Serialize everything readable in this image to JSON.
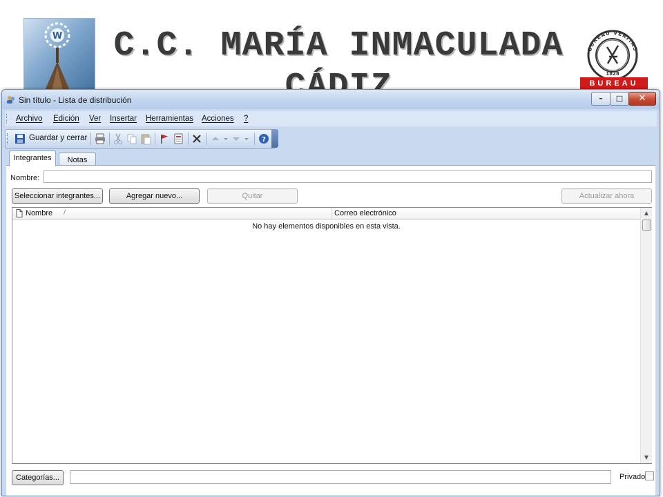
{
  "slide": {
    "title_line1": "C.C. MARÍA INMACULADA",
    "title_line2": "CÁDIZ",
    "certifier_arc_text": "BUREAU VERITAS",
    "certifier_year": "1828",
    "certifier_bar": "BUREAU"
  },
  "window": {
    "title": "Sin título - Lista de distribución",
    "controls": {
      "minimize": "–",
      "maximize": "□",
      "close": "✕"
    }
  },
  "menubar": {
    "items": [
      "Archivo",
      "Edición",
      "Ver",
      "Insertar",
      "Herramientas",
      "Acciones",
      "?"
    ]
  },
  "toolbar": {
    "save_close_label": "Guardar y cerrar",
    "icons": [
      "save-icon",
      "print-icon",
      "cut-icon",
      "copy-icon",
      "paste-icon",
      "flag-icon",
      "address-book-icon",
      "delete-icon",
      "previous-icon",
      "next-icon",
      "help-icon"
    ]
  },
  "tabs": [
    {
      "label": "Integrantes",
      "active": true
    },
    {
      "label": "Notas",
      "active": false
    }
  ],
  "form": {
    "name_label": "Nombre:",
    "name_value": "",
    "buttons": {
      "select_members": "Seleccionar integrantes...",
      "add_new": "Agregar nuevo...",
      "remove": "Quitar",
      "update_now": "Actualizar ahora"
    }
  },
  "list": {
    "columns": [
      "Nombre",
      "Correo electrónico"
    ],
    "sort_indicator": "/",
    "empty_message": "No hay elementos disponibles en esta vista."
  },
  "footer": {
    "categories_button": "Categorías...",
    "categories_value": "",
    "private_label": "Privado",
    "private_checked": false
  },
  "colors": {
    "title_text": "#3a3a3a",
    "window_chrome": "#c9daf0",
    "close_button": "#c74a33",
    "certifier_red": "#d11a1a"
  }
}
